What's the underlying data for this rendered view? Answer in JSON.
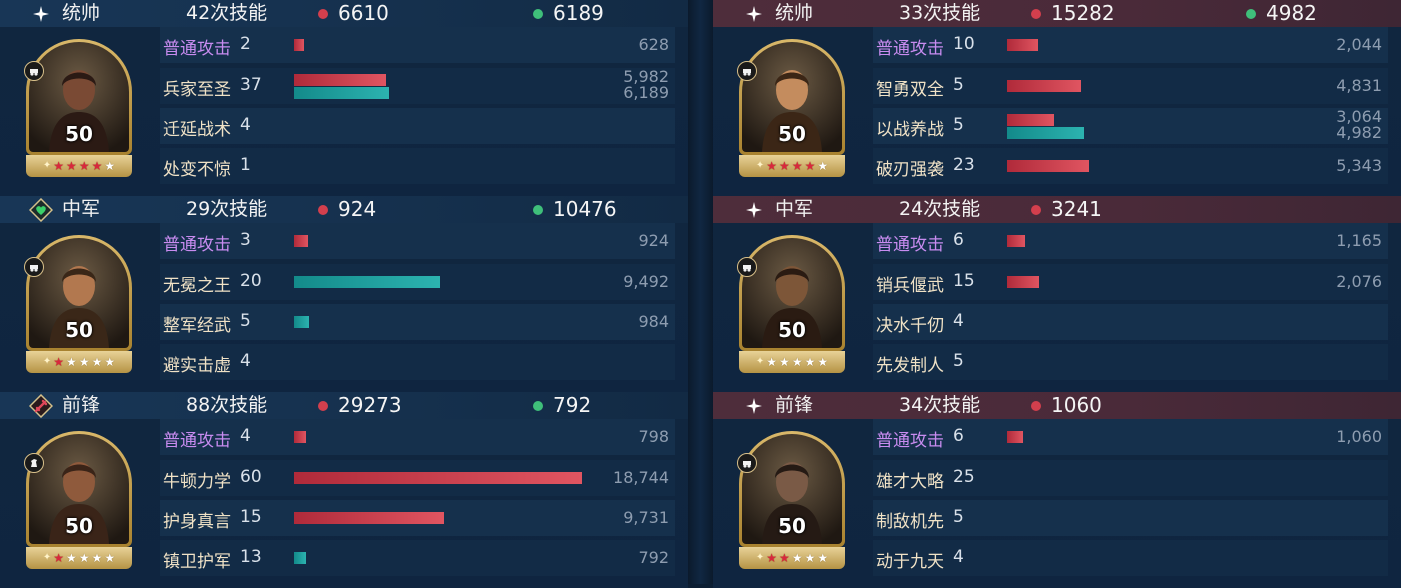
{
  "left": [
    {
      "role": "统帅",
      "role_icon": "sparkle-icon",
      "casts": "42次技能",
      "damage": "6610",
      "heal": "6189",
      "level": "50",
      "stars_red": 4,
      "class_icon": "chariot-icon",
      "skills": [
        {
          "name": "普通攻击",
          "count": "2",
          "normal": true,
          "dmg": 628,
          "heal": null,
          "dmg_label": "628",
          "heal_label": ""
        },
        {
          "name": "兵家至圣",
          "count": "37",
          "normal": false,
          "dmg": 5982,
          "heal": 6189,
          "dmg_label": "5,982",
          "heal_label": "6,189"
        },
        {
          "name": "迁延战术",
          "count": "4",
          "normal": false,
          "dmg": null,
          "heal": null,
          "dmg_label": "",
          "heal_label": ""
        },
        {
          "name": "处变不惊",
          "count": "1",
          "normal": false,
          "dmg": null,
          "heal": null,
          "dmg_label": "",
          "heal_label": ""
        }
      ]
    },
    {
      "role": "中军",
      "role_icon": "heart-shield-icon",
      "casts": "29次技能",
      "damage": "924",
      "heal": "10476",
      "level": "50",
      "stars_red": 1,
      "class_icon": "chariot-icon",
      "skills": [
        {
          "name": "普通攻击",
          "count": "3",
          "normal": true,
          "dmg": 924,
          "heal": null,
          "dmg_label": "924",
          "heal_label": ""
        },
        {
          "name": "无冕之王",
          "count": "20",
          "normal": false,
          "dmg": null,
          "heal": 9492,
          "dmg_label": "",
          "heal_label": "9,492"
        },
        {
          "name": "整军经武",
          "count": "5",
          "normal": false,
          "dmg": null,
          "heal": 984,
          "dmg_label": "",
          "heal_label": "984"
        },
        {
          "name": "避实击虚",
          "count": "4",
          "normal": false,
          "dmg": null,
          "heal": null,
          "dmg_label": "",
          "heal_label": ""
        }
      ]
    },
    {
      "role": "前锋",
      "role_icon": "sword-icon",
      "casts": "88次技能",
      "damage": "29273",
      "heal": "792",
      "level": "50",
      "stars_red": 1,
      "class_icon": "horse-icon",
      "skills": [
        {
          "name": "普通攻击",
          "count": "4",
          "normal": true,
          "dmg": 798,
          "heal": null,
          "dmg_label": "798",
          "heal_label": ""
        },
        {
          "name": "牛顿力学",
          "count": "60",
          "normal": false,
          "dmg": 18744,
          "heal": null,
          "dmg_label": "18,744",
          "heal_label": ""
        },
        {
          "name": "护身真言",
          "count": "15",
          "normal": false,
          "dmg": 9731,
          "heal": null,
          "dmg_label": "9,731",
          "heal_label": ""
        },
        {
          "name": "镇卫护军",
          "count": "13",
          "normal": false,
          "dmg": null,
          "heal": 792,
          "dmg_label": "",
          "heal_label": "792"
        }
      ]
    }
  ],
  "right": [
    {
      "role": "统帅",
      "role_icon": "sparkle-icon",
      "casts": "33次技能",
      "damage": "15282",
      "heal": "4982",
      "level": "50",
      "stars_red": 4,
      "class_icon": "chariot-icon",
      "skills": [
        {
          "name": "普通攻击",
          "count": "10",
          "normal": true,
          "dmg": 2044,
          "heal": null,
          "dmg_label": "2,044",
          "heal_label": ""
        },
        {
          "name": "智勇双全",
          "count": "5",
          "normal": false,
          "dmg": 4831,
          "heal": null,
          "dmg_label": "4,831",
          "heal_label": ""
        },
        {
          "name": "以战养战",
          "count": "5",
          "normal": false,
          "dmg": 3064,
          "heal": 4982,
          "dmg_label": "3,064",
          "heal_label": "4,982"
        },
        {
          "name": "破刃强袭",
          "count": "23",
          "normal": false,
          "dmg": 5343,
          "heal": null,
          "dmg_label": "5,343",
          "heal_label": ""
        }
      ]
    },
    {
      "role": "中军",
      "role_icon": "sparkle-icon",
      "casts": "24次技能",
      "damage": "3241",
      "heal": null,
      "level": "50",
      "stars_red": 0,
      "class_icon": "chariot-icon",
      "skills": [
        {
          "name": "普通攻击",
          "count": "6",
          "normal": true,
          "dmg": 1165,
          "heal": null,
          "dmg_label": "1,165",
          "heal_label": ""
        },
        {
          "name": "销兵偃武",
          "count": "15",
          "normal": false,
          "dmg": 2076,
          "heal": null,
          "dmg_label": "2,076",
          "heal_label": ""
        },
        {
          "name": "决水千仞",
          "count": "4",
          "normal": false,
          "dmg": null,
          "heal": null,
          "dmg_label": "",
          "heal_label": ""
        },
        {
          "name": "先发制人",
          "count": "5",
          "normal": false,
          "dmg": null,
          "heal": null,
          "dmg_label": "",
          "heal_label": ""
        }
      ]
    },
    {
      "role": "前锋",
      "role_icon": "sparkle-icon",
      "casts": "34次技能",
      "damage": "1060",
      "heal": null,
      "level": "50",
      "stars_red": 2,
      "class_icon": "chariot-icon",
      "skills": [
        {
          "name": "普通攻击",
          "count": "6",
          "normal": true,
          "dmg": 1060,
          "heal": null,
          "dmg_label": "1,060",
          "heal_label": ""
        },
        {
          "name": "雄才大略",
          "count": "25",
          "normal": false,
          "dmg": null,
          "heal": null,
          "dmg_label": "",
          "heal_label": ""
        },
        {
          "name": "制敌机先",
          "count": "5",
          "normal": false,
          "dmg": null,
          "heal": null,
          "dmg_label": "",
          "heal_label": ""
        },
        {
          "name": "动于九天",
          "count": "4",
          "normal": false,
          "dmg": null,
          "heal": null,
          "dmg_label": "",
          "heal_label": ""
        }
      ]
    }
  ],
  "colors": {
    "damage": "#d33f4d",
    "heal": "#3fbf7a",
    "bar_damage": "#c93a49",
    "bar_heal": "#21a3a0",
    "normal_attack": "#c88cf0",
    "skill_name": "#f0e2c6"
  }
}
